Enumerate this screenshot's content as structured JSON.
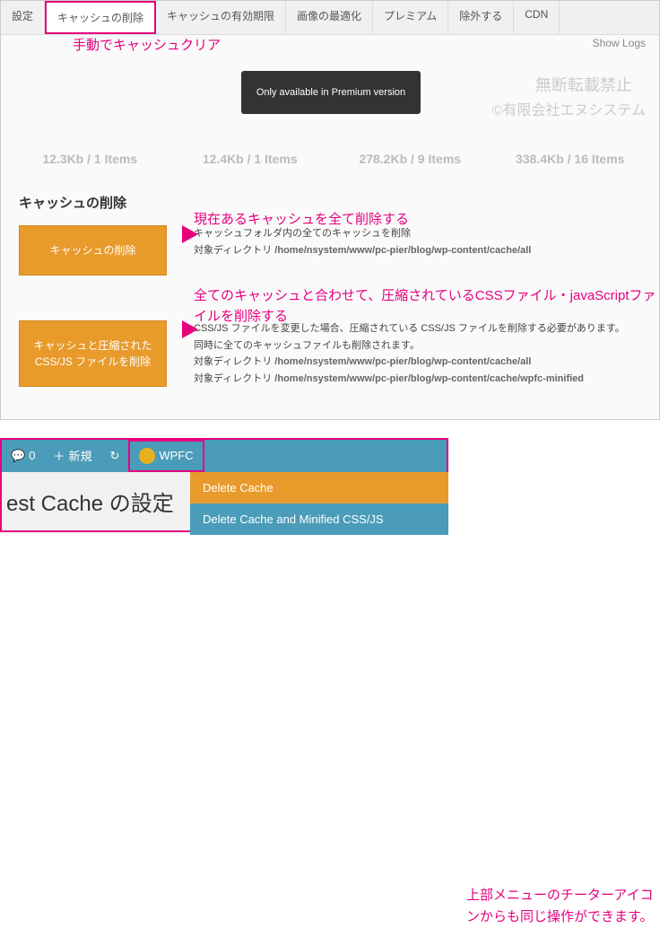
{
  "tabs": [
    "設定",
    "キャッシュの削除",
    "キャッシュの有効期限",
    "画像の最適化",
    "プレミアム",
    "除外する",
    "CDN"
  ],
  "activeTab": 1,
  "annotations": {
    "a1": "手動でキャッシュクリア",
    "a2": "現在あるキャッシュを全て削除する",
    "a3": "全てのキャッシュと合わせて、圧縮されているCSSファイル・javaScriptファイルを削除する",
    "a4": "上部メニューのチーターアイコンからも同じ操作ができます。"
  },
  "showLogs": "Show Logs",
  "watermark1": "無断転載禁止",
  "watermark2": "©有限会社エヌシステム",
  "tooltip": "Only available in Premium version",
  "stats": [
    "12.3Kb / 1 Items",
    "12.4Kb / 1 Items",
    "278.2Kb / 9 Items",
    "338.4Kb / 16 Items"
  ],
  "sectionTitle": "キャッシュの削除",
  "btn1": "キャッシュの削除",
  "desc1a": "キャッシュフォルダ内の全てのキャッシュを削除",
  "desc1b": "対象ディレクトリ ",
  "path1": "/home/nsystem/www/pc-pier/blog/wp-content/cache/all",
  "btn2": "キャッシュと圧縮された CSS/JS ファイルを削除",
  "desc2a": "CSS/JS ファイルを変更した場合、圧縮されている CSS/JS ファイルを削除する必要があります。",
  "desc2b": "同時に全てのキャッシュファイルも削除されます。",
  "desc2c": "対象ディレクトリ ",
  "path2a": "/home/nsystem/www/pc-pier/blog/wp-content/cache/all",
  "path2b": "/home/nsystem/www/pc-pier/blog/wp-content/cache/wpfc-minified",
  "adminbar": {
    "comments": "0",
    "new": "新規",
    "wpfc": "WPFC"
  },
  "pageTitle": "est Cache の設定",
  "dropdown": [
    "Delete Cache",
    "Delete Cache and Minified CSS/JS"
  ]
}
